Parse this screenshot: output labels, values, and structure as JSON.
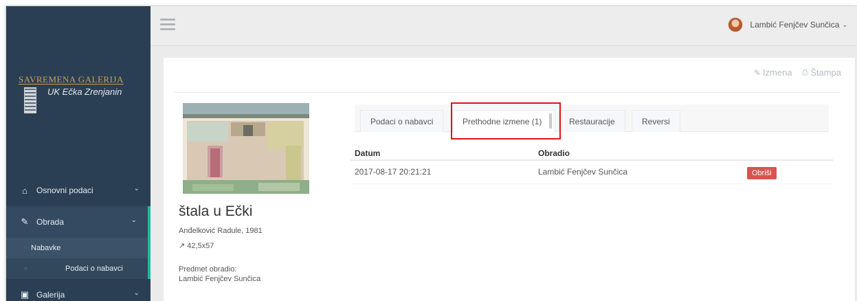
{
  "sidebar": {
    "logo_title": "SAVREMENA GALERIJA",
    "logo_subtitle": "UK Ečka Zrenjanin",
    "items": [
      {
        "label": "Osnovni podaci",
        "icon": "home-icon"
      },
      {
        "label": "Obrada",
        "icon": "edit-icon"
      },
      {
        "label": "Galerija",
        "icon": "image-icon"
      }
    ],
    "sub_items": [
      {
        "label": "Nabavke"
      },
      {
        "label": "Podaci o nabavci"
      }
    ]
  },
  "topbar": {
    "user_name": "Lambić Fenjčev Sunčica"
  },
  "actions": {
    "edit_label": "Izmena",
    "print_label": "Štampa"
  },
  "artwork": {
    "title": "štala u Ečki",
    "author_year": "Anđelković Radule, 1981",
    "dimensions": "42,5x57",
    "processed_by_label": "Predmet obradio:",
    "processed_by": "Lambić Fenjčev Sunčica"
  },
  "tabs": [
    {
      "label": "Podaci o nabavci"
    },
    {
      "label": "Prethodne izmene (1)"
    },
    {
      "label": "Restauracije"
    },
    {
      "label": "Reversi"
    }
  ],
  "table": {
    "headers": [
      "Datum",
      "Obradio"
    ],
    "rows": [
      {
        "date": "2017-08-17 20:21:21",
        "user": "Lambić Fenjčev Sunčica",
        "action": "Obriši"
      }
    ]
  },
  "colors": {
    "sidebar_bg": "#2a3f54",
    "accent": "#1abb9c",
    "danger": "#d9534f",
    "highlight": "#e01313"
  }
}
